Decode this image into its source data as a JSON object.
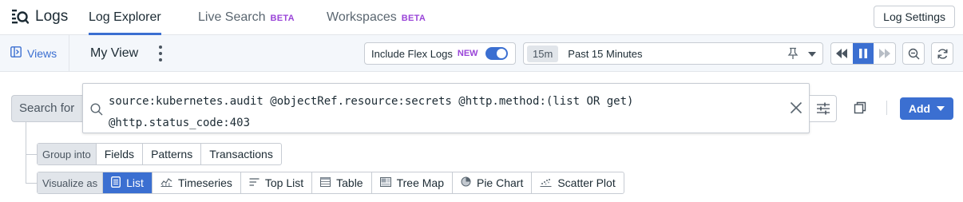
{
  "topnav": {
    "brand": "Logs",
    "tabs": [
      {
        "label": "Log Explorer",
        "active": true,
        "badge": ""
      },
      {
        "label": "Live Search",
        "active": false,
        "badge": "BETA"
      },
      {
        "label": "Workspaces",
        "active": false,
        "badge": "BETA"
      }
    ],
    "settings_label": "Log Settings"
  },
  "subbar": {
    "views_label": "Views",
    "view_name": "My View",
    "flex_logs": {
      "label": "Include Flex Logs",
      "badge": "NEW",
      "enabled": true
    },
    "time": {
      "chip": "15m",
      "label": "Past 15 Minutes"
    }
  },
  "search": {
    "prefix": "Search for",
    "query_line1": "source:kubernetes.audit @objectRef.resource:secrets @http.method:(list OR get)",
    "query_line2": "@http.status_code:403",
    "add_label": "Add"
  },
  "group_into": {
    "label": "Group into",
    "options": [
      "Fields",
      "Patterns",
      "Transactions"
    ]
  },
  "visualize_as": {
    "label": "Visualize as",
    "selected": "List",
    "options": [
      {
        "label": "List",
        "icon": "list-icon"
      },
      {
        "label": "Timeseries",
        "icon": "timeseries-icon"
      },
      {
        "label": "Top List",
        "icon": "top-list-icon"
      },
      {
        "label": "Table",
        "icon": "table-icon"
      },
      {
        "label": "Tree Map",
        "icon": "tree-map-icon"
      },
      {
        "label": "Pie Chart",
        "icon": "pie-chart-icon"
      },
      {
        "label": "Scatter Plot",
        "icon": "scatter-plot-icon"
      }
    ]
  },
  "colors": {
    "accent": "#3b6fd1",
    "beta": "#9a45d8"
  }
}
